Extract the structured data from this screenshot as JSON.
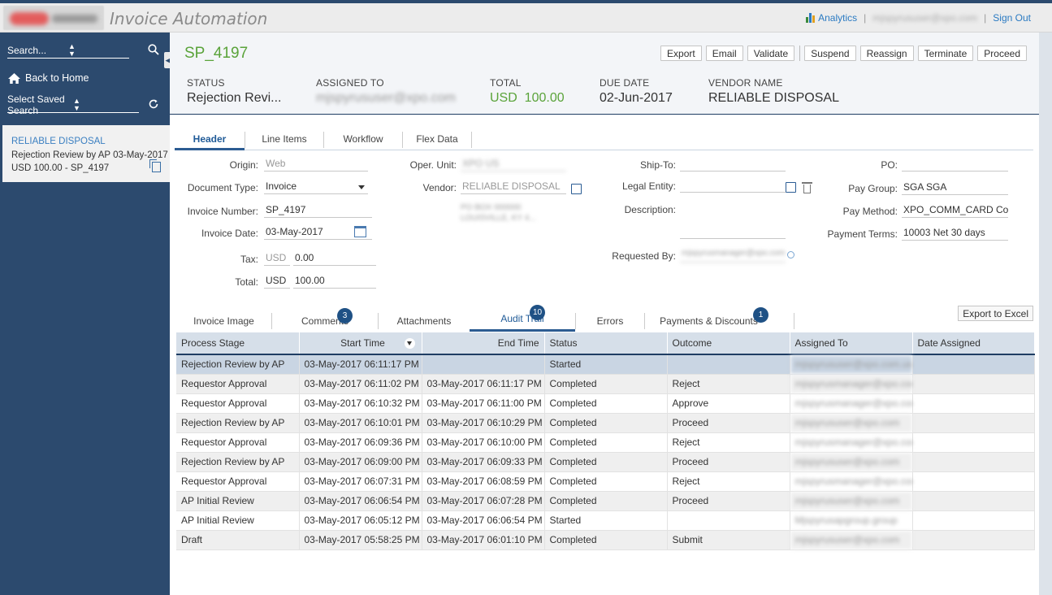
{
  "app": {
    "title": "Invoice Automation",
    "analytics_label": "Analytics",
    "user_email": "mjspyrususer@xpo.com",
    "sign_out_label": "Sign Out",
    "sep": "|"
  },
  "sidebar": {
    "search_placeholder": "Search...",
    "back_home_label": "Back to Home",
    "saved_search_label": "Select Saved Search",
    "card": {
      "vendor": "RELIABLE DISPOSAL",
      "line2": "Rejection Review by AP 03-May-2017",
      "line3": "USD 100.00 - SP_4197"
    }
  },
  "header": {
    "doc_id": "SP_4197",
    "actions": [
      "Export",
      "Email",
      "Validate",
      "Suspend",
      "Reassign",
      "Terminate",
      "Proceed"
    ],
    "status_label": "STATUS",
    "status_value": "Rejection Revi...",
    "assigned_label": "ASSIGNED TO",
    "assigned_value": "mjspyrususer@xpo.com",
    "total_label": "TOTAL",
    "total_currency": "USD",
    "total_value": "100.00",
    "due_label": "DUE DATE",
    "due_value": "02-Jun-2017",
    "vendor_label": "VENDOR NAME",
    "vendor_value": "RELIABLE DISPOSAL"
  },
  "tabs_top": [
    "Header",
    "Line Items",
    "Workflow",
    "Flex Data"
  ],
  "form": {
    "origin_label": "Origin:",
    "origin_value": "Web",
    "doctype_label": "Document Type:",
    "doctype_value": "Invoice",
    "invnum_label": "Invoice Number:",
    "invnum_value": "SP_4197",
    "invdate_label": "Invoice Date:",
    "invdate_value": "03-May-2017",
    "tax_label": "Tax:",
    "tax_currency": "USD",
    "tax_value": "0.00",
    "total_label": "Total:",
    "total_currency": "USD",
    "total_value": "100.00",
    "operunit_label": "Oper. Unit:",
    "operunit_value": "XPO US",
    "vendor_label": "Vendor:",
    "vendor_value": "RELIABLE DISPOSAL",
    "vendor_addr1": "PO BOX 000000",
    "vendor_addr2": "LOUISVILLE, KY 4...",
    "shipto_label": "Ship-To:",
    "shipto_value": "",
    "legal_label": "Legal Entity:",
    "legal_value": "",
    "desc_label": "Description:",
    "desc_value": "",
    "reqby_label": "Requested By:",
    "reqby_value": "mjspyrusmanager@xpo.com",
    "po_label": "PO:",
    "po_value": "",
    "paygroup_label": "Pay Group:",
    "paygroup_value": "SGA SGA",
    "paymethod_label": "Pay Method:",
    "paymethod_value": "XPO_COMM_CARD Comm",
    "payterms_label": "Payment Terms:",
    "payterms_value": "10003 Net 30 days"
  },
  "tabs_bottom": {
    "invoice_image": "Invoice Image",
    "comments": "Comments",
    "comments_count": "3",
    "attachments": "Attachments",
    "audit_trail": "Audit Trail",
    "audit_count": "10",
    "errors": "Errors",
    "payments": "Payments & Discounts",
    "payments_count": "1",
    "export_excel": "Export to Excel"
  },
  "audit": {
    "columns": [
      "Process Stage",
      "Start Time",
      "End Time",
      "Status",
      "Outcome",
      "Assigned To",
      "Date Assigned"
    ],
    "rows": [
      [
        "Rejection Review by AP",
        "03-May-2017 06:11:17 PM",
        "",
        "Started",
        "",
        "mjspyrususer@xpo.com.user",
        ""
      ],
      [
        "Requestor Approval",
        "03-May-2017 06:11:02 PM",
        "03-May-2017 06:11:17 PM",
        "Completed",
        "Reject",
        "mjspyrusmanager@xpo.com",
        ""
      ],
      [
        "Requestor Approval",
        "03-May-2017 06:10:32 PM",
        "03-May-2017 06:11:00 PM",
        "Completed",
        "Approve",
        "mjspyrusmanager@xpo.com",
        ""
      ],
      [
        "Rejection Review by AP",
        "03-May-2017 06:10:01 PM",
        "03-May-2017 06:10:29 PM",
        "Completed",
        "Proceed",
        "mjspyrususer@xpo.com",
        ""
      ],
      [
        "Requestor Approval",
        "03-May-2017 06:09:36 PM",
        "03-May-2017 06:10:00 PM",
        "Completed",
        "Reject",
        "mjspyrusmanager@xpo.com",
        ""
      ],
      [
        "Rejection Review by AP",
        "03-May-2017 06:09:00 PM",
        "03-May-2017 06:09:33 PM",
        "Completed",
        "Proceed",
        "mjspyrususer@xpo.com",
        ""
      ],
      [
        "Requestor Approval",
        "03-May-2017 06:07:31 PM",
        "03-May-2017 06:08:59 PM",
        "Completed",
        "Reject",
        "mjspyrusmanager@xpo.com",
        ""
      ],
      [
        "AP Initial Review",
        "03-May-2017 06:06:54 PM",
        "03-May-2017 06:07:28 PM",
        "Completed",
        "Proceed",
        "mjspyrususer@xpo.com",
        ""
      ],
      [
        "AP Initial Review",
        "03-May-2017 06:05:12 PM",
        "03-May-2017 06:06:54 PM",
        "Started",
        "",
        "Mjspyrusapgroup.group",
        ""
      ],
      [
        "Draft",
        "03-May-2017 05:58:25 PM",
        "03-May-2017 06:01:10 PM",
        "Completed",
        "Submit",
        "mjspyrususer@xpo.com",
        ""
      ]
    ]
  },
  "colors": {
    "sidebar_bg": "#2c4a6e",
    "accent_blue": "#1f5a97",
    "green": "#5aa33a",
    "selected_row": "#c9d5e3",
    "badge": "#1f5185"
  }
}
